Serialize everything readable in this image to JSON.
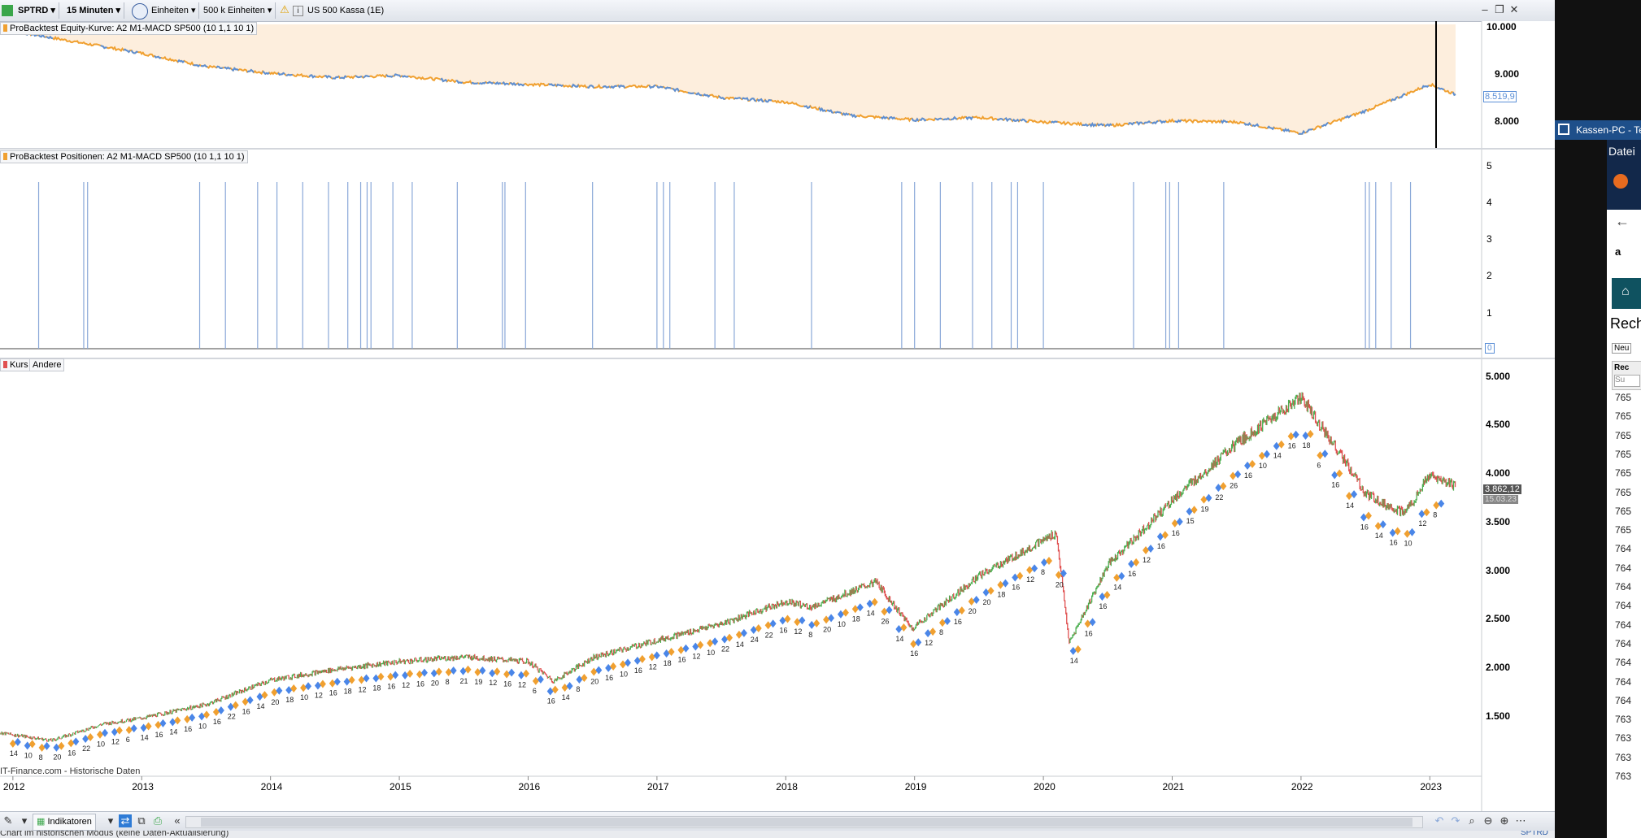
{
  "toolbar": {
    "symbol": "SPTRD",
    "interval": "15 Minuten",
    "units_mode": "Einheiten",
    "size": "500 k Einheiten",
    "instrument": "US 500 Kassa (1E)"
  },
  "panes": {
    "equity": {
      "label": "ProBacktest Equity-Kurve: A2 M1-MACD SP500 (10 1,1 10 1)",
      "ticks": [
        "10.000",
        "9.000",
        "8.000"
      ],
      "current": "8.519,9"
    },
    "positions": {
      "label": "ProBacktest Positionen: A2 M1-MACD SP500 (10 1,1 10 1)",
      "ticks": [
        "5",
        "4",
        "3",
        "2",
        "1"
      ],
      "zero": "0"
    },
    "price": {
      "label_kurs": "Kurs",
      "label_andere": "Andere",
      "ticks": [
        "5.000",
        "4.500",
        "4.000",
        "3.500",
        "3.000",
        "2.500",
        "2.000",
        "1.500"
      ],
      "current": "3.862,12",
      "current_date": "15.03.23",
      "source": "IT-Finance.com - Historische Daten"
    }
  },
  "x_axis": [
    "2012",
    "2013",
    "2014",
    "2015",
    "2016",
    "2017",
    "2018",
    "2019",
    "2020",
    "2021",
    "2022",
    "2023"
  ],
  "bottombar": {
    "indicators": "Indikatoren"
  },
  "statusbar": {
    "text": "Chart im historischen Modus (keine Daten-Aktualisierung)",
    "right": "SPTRD"
  },
  "side_window": {
    "title": "Kassen-PC - Te",
    "menu": "Datei",
    "heading": "Rech",
    "button": "Neu",
    "col": "Rec",
    "search": "Su",
    "rows": [
      "765",
      "765",
      "765",
      "765",
      "765",
      "765",
      "765",
      "765",
      "764",
      "764",
      "764",
      "764",
      "764",
      "764",
      "764",
      "764",
      "764",
      "763",
      "763",
      "763",
      "763"
    ]
  },
  "colors": {
    "equity_line_up": "#5b8fd6",
    "equity_line_down": "#f0a030",
    "equity_fill": "#fdeedd",
    "position_bar": "#8aa8d8",
    "candle_up": "#4caf50",
    "candle_down": "#e05050",
    "buy_marker": "#4a86e8",
    "sell_marker": "#f0a030"
  },
  "chart_data": [
    {
      "type": "line",
      "title": "ProBacktest Equity-Kurve: A2 M1-MACD SP500 (10 1,1 10 1)",
      "x": [
        "2011.9",
        "2012.5",
        "2013.0",
        "2013.5",
        "2014.0",
        "2014.5",
        "2015.0",
        "2015.5",
        "2016.0",
        "2016.5",
        "2017.0",
        "2017.5",
        "2018.0",
        "2018.5",
        "2019.0",
        "2019.5",
        "2020.0",
        "2020.5",
        "2021.0",
        "2021.5",
        "2022.0",
        "2022.5",
        "2023.0",
        "2023.2"
      ],
      "series": [
        {
          "values": [
            10000,
            9700,
            9450,
            9150,
            9000,
            8900,
            8950,
            8800,
            8750,
            8700,
            8700,
            8450,
            8350,
            8050,
            7950,
            8000,
            7900,
            7820,
            7930,
            7900,
            7650,
            8150,
            8750,
            8520
          ]
        }
      ],
      "ylim": [
        7500,
        10100
      ]
    },
    {
      "type": "bar",
      "title": "ProBacktest Positionen: A2 M1-MACD SP500 (10 1,1 10 1)",
      "x": [
        2012.2,
        2012.55,
        2012.58,
        2013.45,
        2013.65,
        2013.9,
        2014.05,
        2014.25,
        2014.45,
        2014.6,
        2014.7,
        2014.75,
        2014.78,
        2014.95,
        2015.1,
        2015.45,
        2015.8,
        2015.82,
        2015.98,
        2016.5,
        2017.0,
        2017.05,
        2017.1,
        2017.45,
        2017.6,
        2018.2,
        2018.9,
        2019.0,
        2019.2,
        2019.45,
        2019.6,
        2019.75,
        2019.8,
        2020.0,
        2020.7,
        2020.95,
        2020.98,
        2021.05,
        2021.4,
        2022.5,
        2022.53,
        2022.58,
        2022.7,
        2022.85
      ],
      "values": [
        5,
        5,
        5,
        5,
        5,
        5,
        5,
        5,
        5,
        5,
        5,
        5,
        5,
        5,
        5,
        5,
        5,
        5,
        5,
        5,
        5,
        5,
        5,
        5,
        5,
        5,
        5,
        5,
        5,
        5,
        5,
        5,
        5,
        5,
        5,
        5,
        5,
        5,
        5,
        5,
        5,
        5,
        5,
        5
      ],
      "ylim": [
        0,
        5
      ]
    },
    {
      "type": "line",
      "title": "Kurs",
      "x": [
        "2011.9",
        "2012.3",
        "2012.7",
        "2013.0",
        "2013.5",
        "2014.0",
        "2014.5",
        "2015.0",
        "2015.5",
        "2016.0",
        "2016.2",
        "2016.5",
        "2017.0",
        "2017.5",
        "2018.0",
        "2018.2",
        "2018.7",
        "2018.98",
        "2019.5",
        "2020.1",
        "2020.2",
        "2020.5",
        "2021.0",
        "2021.5",
        "2022.0",
        "2022.3",
        "2022.5",
        "2022.8",
        "2023.0",
        "2023.2"
      ],
      "series": [
        {
          "values": [
            1330,
            1250,
            1420,
            1480,
            1620,
            1870,
            1980,
            2060,
            2110,
            2060,
            1860,
            2100,
            2280,
            2450,
            2680,
            2620,
            2880,
            2400,
            2940,
            3380,
            2250,
            3050,
            3720,
            4300,
            4780,
            4200,
            3780,
            3580,
            3970,
            3860
          ]
        }
      ],
      "ylim": [
        1100,
        5000
      ],
      "annotations": [
        "14",
        "10",
        "8",
        "20",
        "16",
        "22",
        "10",
        "12",
        "6",
        "14",
        "16",
        "14",
        "16",
        "10",
        "16",
        "22",
        "16",
        "14",
        "20",
        "18",
        "10",
        "12",
        "16",
        "18",
        "12",
        "18",
        "16",
        "12",
        "16",
        "20",
        "8",
        "21",
        "19",
        "12",
        "16",
        "12",
        "6",
        "16",
        "14",
        "8",
        "20",
        "16",
        "10",
        "16",
        "12",
        "18",
        "16",
        "12",
        "10",
        "22",
        "14",
        "24",
        "22",
        "16",
        "12",
        "8",
        "20",
        "10",
        "18",
        "14",
        "26",
        "14",
        "16",
        "12",
        "8",
        "16",
        "20",
        "20",
        "18",
        "16",
        "12",
        "8",
        "20",
        "14",
        "16",
        "16",
        "14",
        "16",
        "12",
        "16",
        "16",
        "15",
        "19",
        "22",
        "26",
        "16",
        "10",
        "14",
        "16",
        "18",
        "6",
        "16",
        "14",
        "16",
        "14",
        "16",
        "10",
        "12",
        "8"
      ]
    }
  ]
}
